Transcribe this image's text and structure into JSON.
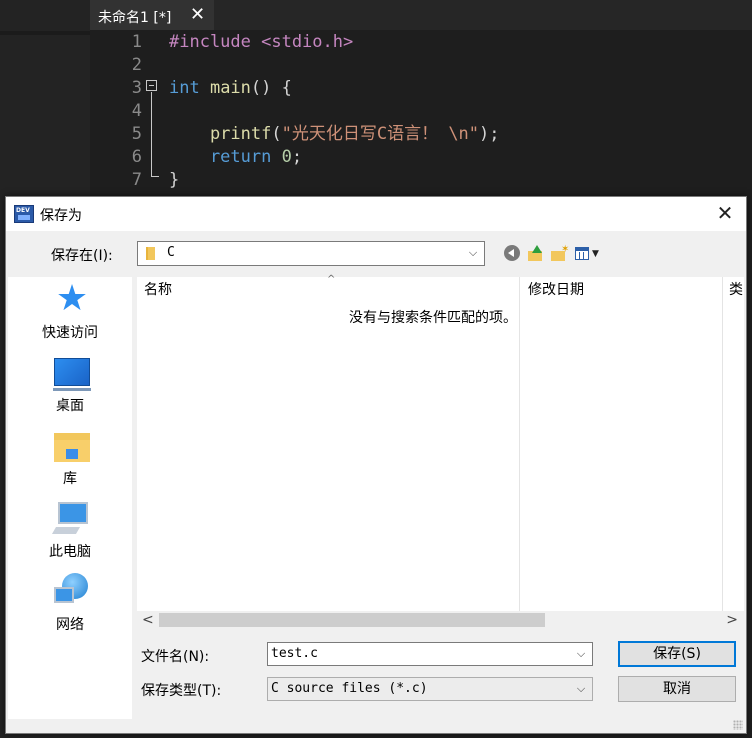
{
  "editor": {
    "tab_title": "未命名1 [*]",
    "tab_close": "✕",
    "lines": [
      {
        "n": "1",
        "tokens": [
          {
            "t": "#include <stdio.h>",
            "c": "pp"
          }
        ]
      },
      {
        "n": "2",
        "tokens": []
      },
      {
        "n": "3",
        "tokens": [
          {
            "t": "int ",
            "c": "kw"
          },
          {
            "t": "main",
            "c": "fn"
          },
          {
            "t": "() {",
            "c": "pl"
          }
        ]
      },
      {
        "n": "4",
        "tokens": []
      },
      {
        "n": "5",
        "tokens": [
          {
            "t": "    printf",
            "c": "fn"
          },
          {
            "t": "(",
            "c": "pl"
          },
          {
            "t": "\"光天化日写C语言！ \\n\"",
            "c": "str"
          },
          {
            "t": ");",
            "c": "pl"
          }
        ]
      },
      {
        "n": "6",
        "tokens": [
          {
            "t": "    return ",
            "c": "kw"
          },
          {
            "t": "0",
            "c": "num"
          },
          {
            "t": ";",
            "c": "pl"
          }
        ]
      },
      {
        "n": "7",
        "tokens": [
          {
            "t": "}",
            "c": "pl"
          }
        ]
      }
    ]
  },
  "dialog": {
    "title": "保存为",
    "close": "✕",
    "save_in_label": "保存在(I):",
    "save_in_value": "C",
    "combo_arrow": "⌵",
    "places": [
      {
        "label": "快速访问",
        "icon": "star-icon"
      },
      {
        "label": "桌面",
        "icon": "desktop-icon"
      },
      {
        "label": "库",
        "icon": "library-icon"
      },
      {
        "label": "此电脑",
        "icon": "computer-icon"
      },
      {
        "label": "网络",
        "icon": "network-icon"
      }
    ],
    "columns": {
      "name": "名称",
      "date": "修改日期",
      "type": "类"
    },
    "sort_caret": "^",
    "empty_message": "没有与搜索条件匹配的项。",
    "scroll_left": "<",
    "scroll_right": ">",
    "filename_label": "文件名(N):",
    "filename_value": "test.c",
    "filetype_label": "保存类型(T):",
    "filetype_value": "C source files (*.c)",
    "save_button": "保存(S)",
    "cancel_button": "取消"
  }
}
